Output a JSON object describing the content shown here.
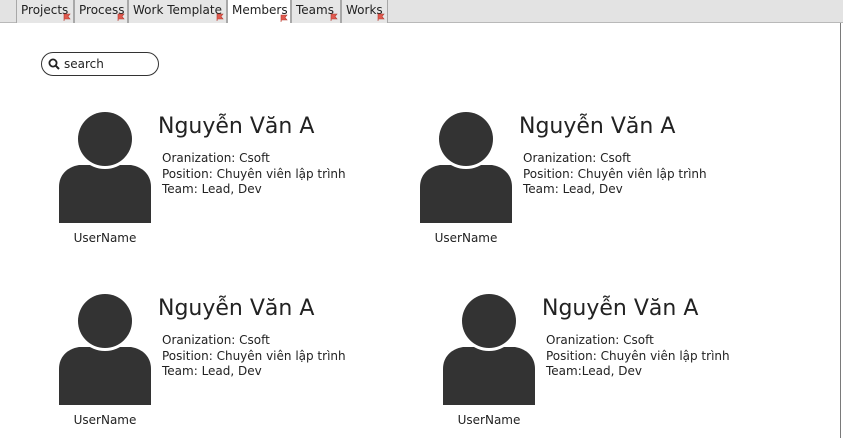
{
  "tabs": [
    {
      "label": "Projects",
      "active": false
    },
    {
      "label": "Process",
      "active": false
    },
    {
      "label": "Work Template",
      "active": false
    },
    {
      "label": "Members",
      "active": true
    },
    {
      "label": "Teams",
      "active": false
    },
    {
      "label": "Works",
      "active": false
    }
  ],
  "search": {
    "placeholder": "search",
    "value": ""
  },
  "members": [
    {
      "name": "Nguyễn Văn A",
      "organization": "Oranization: Csoft",
      "position": "Position: Chuyên viên lập trình",
      "team": "Team: Lead, Dev",
      "username": "UserName"
    },
    {
      "name": "Nguyễn Văn A",
      "organization": "Oranization: Csoft",
      "position": "Position: Chuyên viên lập trình",
      "team": "Team: Lead, Dev",
      "username": "UserName"
    },
    {
      "name": "Nguyễn Văn A",
      "organization": "Oranization: Csoft",
      "position": "Position: Chuyên viên lập trình",
      "team": "Team: Lead, Dev",
      "username": "UserName"
    },
    {
      "name": "Nguyễn Văn A",
      "organization": "Oranization: Csoft",
      "position": "Position: Chuyên viên lập trình",
      "team": "Team:Lead, Dev",
      "username": "UserName"
    }
  ],
  "colors": {
    "avatar": "#333333",
    "tab_flag": "#d9534f"
  }
}
